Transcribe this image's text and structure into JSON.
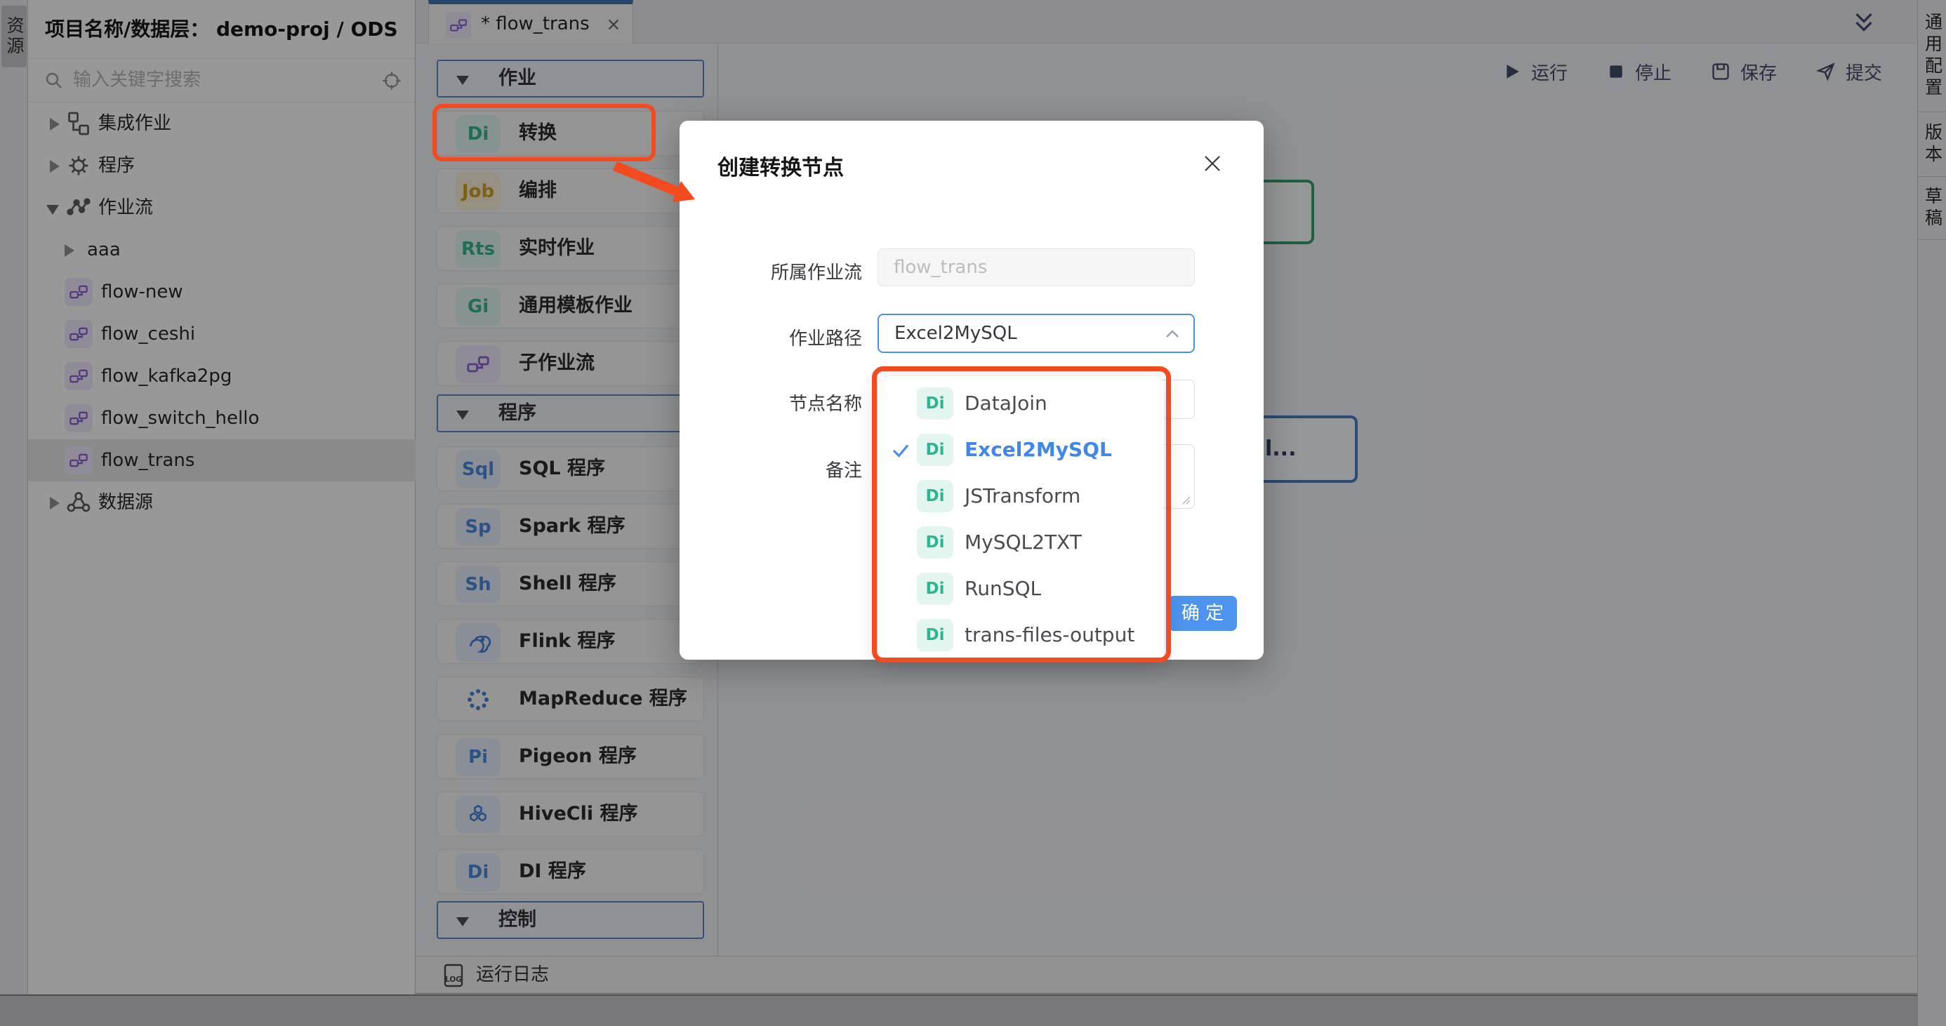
{
  "resource_tab": {
    "label": "资源"
  },
  "sidebar": {
    "title": "项目名称/数据层： demo-proj / ODS",
    "search": {
      "placeholder": "输入关键字搜索"
    },
    "tree": {
      "integration": "集成作业",
      "program": "程序",
      "workflow": "作业流",
      "sub": "aaa",
      "flows": [
        "flow-new",
        "flow_ceshi",
        "flow_kafka2pg",
        "flow_switch_hello",
        "flow_trans"
      ],
      "datasource": "数据源"
    }
  },
  "editor": {
    "tab": {
      "title": "* flow_trans"
    },
    "toolbar": {
      "run": "运行",
      "stop": "停止",
      "save": "保存",
      "submit": "提交"
    },
    "palette": {
      "headers": {
        "job": "作业",
        "program": "程序",
        "control": "控制"
      },
      "job_items": [
        {
          "badge": "Di",
          "label": "转换"
        },
        {
          "badge": "Job",
          "label": "编排"
        },
        {
          "badge": "Rts",
          "label": "实时作业"
        },
        {
          "badge": "Gi",
          "label": "通用模板作业"
        },
        {
          "badge": "",
          "label": "子作业流"
        }
      ],
      "program_items": [
        {
          "badge": "Sql",
          "label": "SQL 程序"
        },
        {
          "badge": "Sp",
          "label": "Spark 程序"
        },
        {
          "badge": "Sh",
          "label": "Shell 程序"
        },
        {
          "badge": "",
          "label": "Flink 程序"
        },
        {
          "badge": "",
          "label": "MapReduce 程序"
        },
        {
          "badge": "Pi",
          "label": "Pigeon 程序"
        },
        {
          "badge": "",
          "label": "HiveCli 程序"
        },
        {
          "badge": "Di",
          "label": "DI 程序"
        }
      ]
    },
    "canvas": {
      "blue_node_label": "l..."
    },
    "log_bar": {
      "label": "运行日志",
      "icon_text": "LOG"
    },
    "right_tabs": [
      "通用配置",
      "版本",
      "草稿"
    ]
  },
  "modal": {
    "title": "创建转换节点",
    "fields": {
      "workflow_label": "所属作业流",
      "workflow_value": "flow_trans",
      "path_label": "作业路径",
      "path_value": "Excel2MySQL",
      "name_label": "节点名称",
      "remark_label": "备注"
    },
    "ok": "确 定",
    "dropdown": {
      "badge": "Di",
      "selected": "Excel2MySQL",
      "options": [
        "DataJoin",
        "Excel2MySQL",
        "JSTransform",
        "MySQL2TXT",
        "RunSQL",
        "trans-files-output"
      ]
    }
  },
  "colors": {
    "annotation_red": "#f34a1f",
    "primary_blue": "#4a90e8",
    "teal": "#2db492",
    "purple": "#8b5cd6",
    "node_green": "#2f9e6a"
  }
}
